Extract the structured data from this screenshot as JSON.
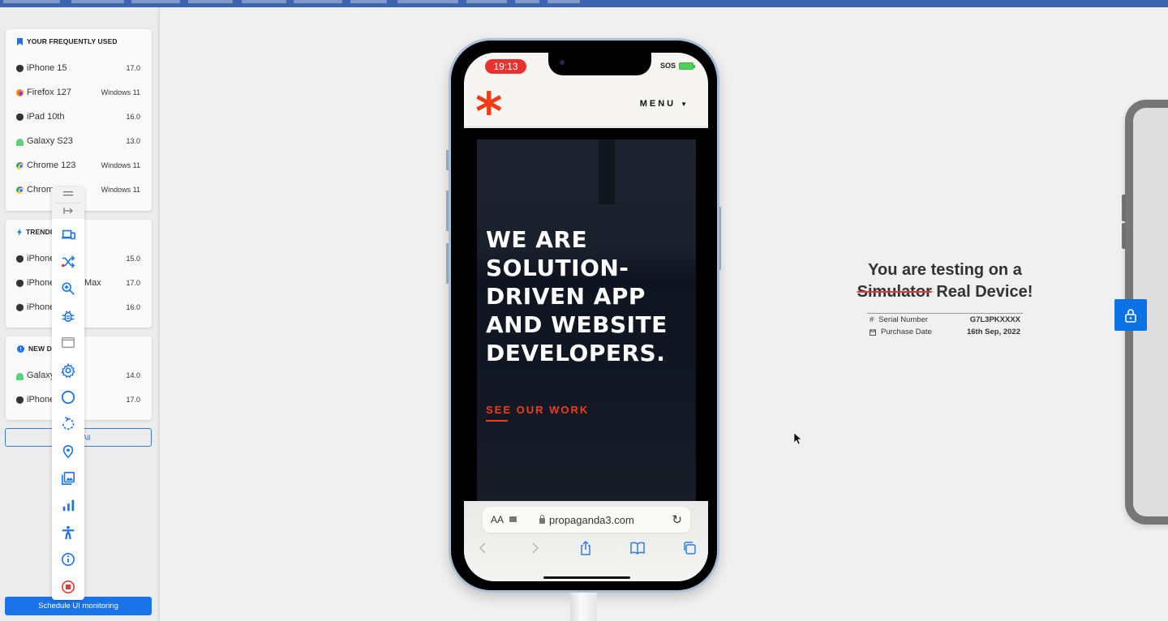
{
  "sidebar": {
    "frequently_used": {
      "title": "YOUR FREQUENTLY USED",
      "items": [
        {
          "name": "iPhone 15",
          "version": "17.0",
          "icon": "apple-icon"
        },
        {
          "name": "Firefox 127",
          "version": "Windows 11",
          "icon": "firefox-icon"
        },
        {
          "name": "iPad 10th",
          "version": "16.0",
          "icon": "apple-icon"
        },
        {
          "name": "Galaxy S23",
          "version": "13.0",
          "icon": "android-icon"
        },
        {
          "name": "Chrome 123",
          "version": "Windows 11",
          "icon": "chrome-icon"
        },
        {
          "name": "Chrom",
          "version": "Windows 11",
          "icon": "chrome-icon"
        }
      ]
    },
    "trending": {
      "title": "TRENDI",
      "items": [
        {
          "name": "iPhone",
          "suffix": "",
          "version": "15.0",
          "icon": "apple-icon"
        },
        {
          "name": "iPhone",
          "suffix": "Max",
          "version": "17.0",
          "icon": "apple-icon"
        },
        {
          "name": "iPhone",
          "suffix": "",
          "version": "16.0",
          "icon": "apple-icon"
        }
      ]
    },
    "new_devices": {
      "title": "NEW DE",
      "items": [
        {
          "name": "Galaxy",
          "version": "14.0",
          "icon": "android-icon"
        },
        {
          "name": "iPhone",
          "version": "17.0",
          "icon": "apple-icon"
        }
      ]
    },
    "view_all_label": "All",
    "schedule_label": "Schedule UI monitoring"
  },
  "toolbar": {
    "items": [
      "drag-handle",
      "collapse",
      "switch-device",
      "shuffle",
      "zoom-in",
      "debug",
      "window",
      "settings",
      "home",
      "rotate",
      "location",
      "gallery",
      "network",
      "accessibility",
      "info",
      "stop-recording"
    ]
  },
  "device": {
    "status_time": "19:13",
    "status_sos": "SOS",
    "site": {
      "logo": "*",
      "menu_label": "MENU",
      "menu_caret": "▼",
      "headline": [
        "WE ARE",
        "SOLUTION-",
        "DRIVEN APP",
        "AND WEBSITE",
        "DEVELOPERS."
      ],
      "cta": "SEE OUR WORK"
    },
    "safari": {
      "text_size_label": "AA",
      "url": "propaganda3.com",
      "reload": "↻"
    }
  },
  "info_panel": {
    "title_line1": "You are testing on a",
    "struck_word": "Simulator",
    "title_rest": "Real Device!",
    "rows": [
      {
        "icon": "#",
        "label": "Serial Number",
        "value": "G7L3PKXXXX"
      },
      {
        "icon": "calendar",
        "label": "Purchase Date",
        "value": "16th Sep, 2022"
      }
    ]
  },
  "colors": {
    "accent": "#1a73e8",
    "brand_red": "#f23b16",
    "status_red": "#e8322f",
    "topbar": "#3d64ae"
  }
}
